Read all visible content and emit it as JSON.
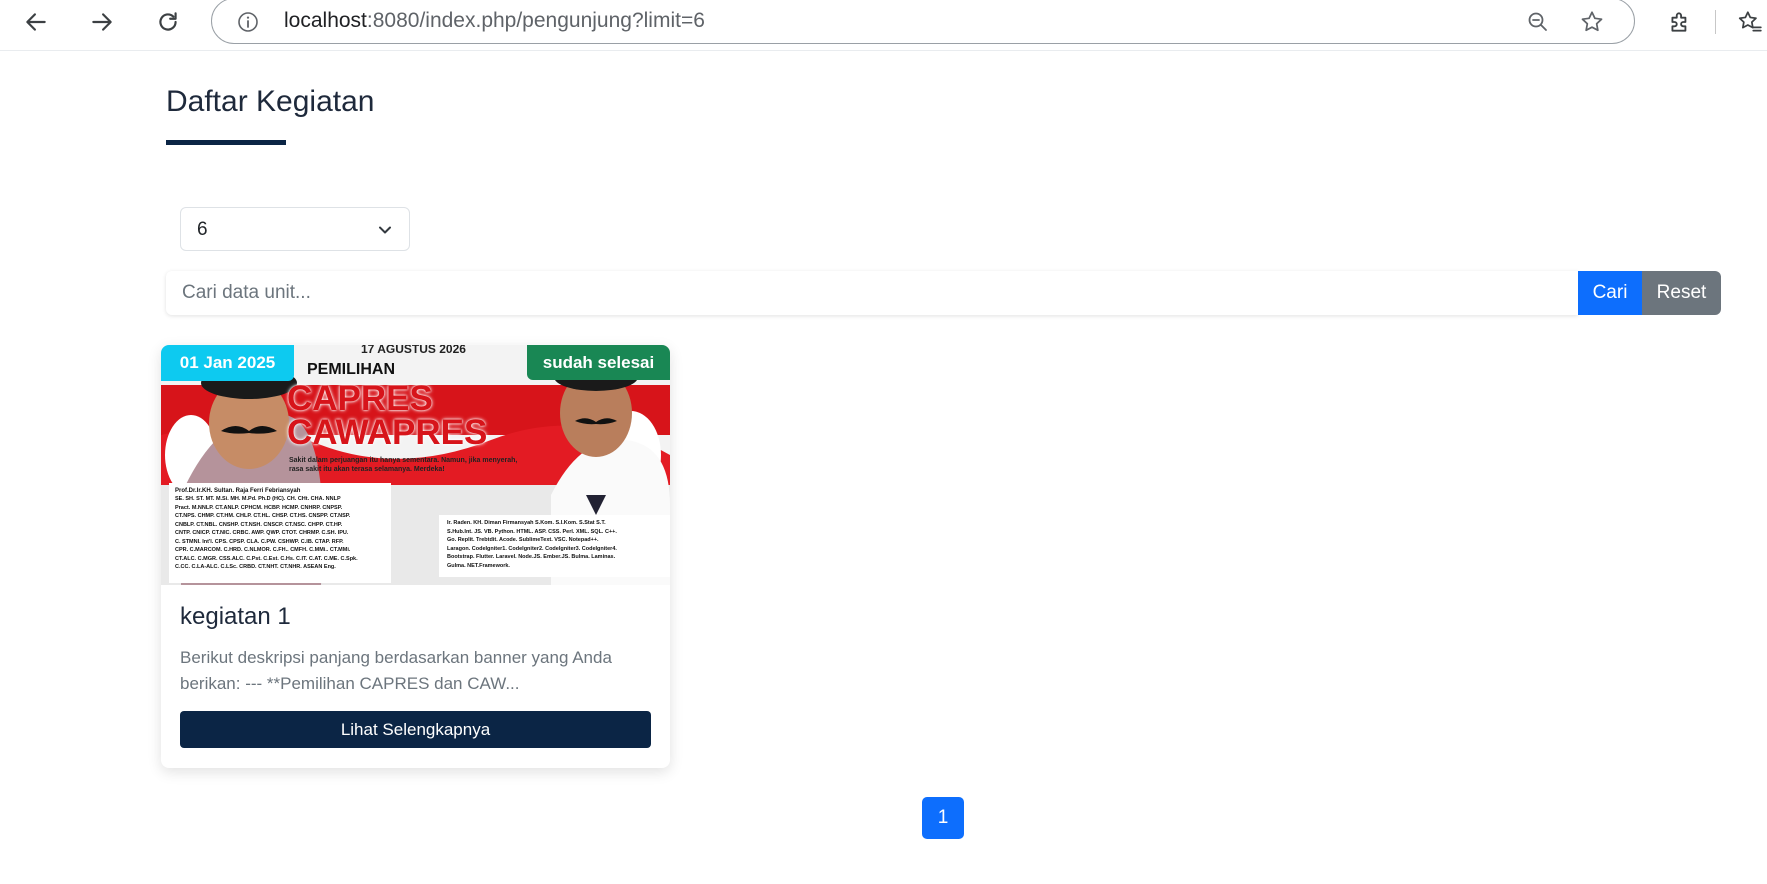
{
  "browser": {
    "url_host": "localhost",
    "url_rest": ":8080/index.php/pengunjung?limit=6"
  },
  "page": {
    "title": "Daftar Kegiatan"
  },
  "filter": {
    "limit_value": "6",
    "search_placeholder": "Cari data unit...",
    "search_button": "Cari",
    "reset_button": "Reset"
  },
  "cards": [
    {
      "date_badge": "01 Jan 2025",
      "status_badge": "sudah selesai",
      "title": "kegiatan 1",
      "description": "Berikut deskripsi panjang berdasarkan banner yang Anda berikan: --- **Pemilihan CAPRES dan CAW...",
      "button": "Lihat Selengkapnya",
      "banner": {
        "date": "17 AGUSTUS 2026",
        "heading_small": "PEMILIHAN",
        "heading_line1": "CAPRES",
        "heading_line2": "CAWAPRES",
        "tagline_1": "Sakit dalam perjuangan itu hanya sementara. Namun, jika menyerah,",
        "tagline_2": "rasa sakit itu akan terasa selamanya. Merdeka!",
        "left_name": "Prof.Dr.Ir.KH. Sultan. Raja Ferri Febriansyah",
        "left_titles": [
          "SE. SH. ST. MT. M.Si. MH. M.Pd. Ph.D (HC). CH. CHt. CHA. NNLP",
          "Pract. M.NNLP. CT.ANLP. CPHCM. HCBP. HCMP. CNHRP. CNPSP.",
          "CT.NPS. CHMP. CT.HM. CHLP. CT.HL. CHSP. CT.HS. CNSPP. CT.NSP.",
          "CNBLP. CT.NBL. CNSHP. CT.NSH. CNSCP. CT.NSC. CHPP. CT.HP.",
          "CNTP. CNICP. CT.NIC. CRBC. AWP. QWP. CTOT. CHRMP. C.SH. IPU.",
          "C. STMNI. Int'l. CPS. CPSP. CLA. C.PW. CSHWP. C.IB. CTAP. RFP.",
          "CPR. C.MARCOM. C.HRD. C.NLMOR. C.FH.. CMFH. C.MMi.. CT.MMi.",
          "CT.ALC. C.MGR. CSS.ALC. C.Pst. C.Est. C.Hs. C.IT. C.AT. C.ME. C.Spk.",
          "C.CC. C.LA-ALC. C.LSc. CRBD. CT.NHT. CT.NHR. ASEAN Eng."
        ],
        "right_titles": [
          "Ir. Raden. KH. Diman Firmansyah S.Kom. S.I.Kom. S.Stat S.T.",
          "S.Hub.Int. JS. VB. Python. HTML. ASP. CSS. Perl. XML. SQL. C++.",
          "Go. Replit. Trebtdit. Acode. SublimeText. VSC. Notepad++.",
          "Laragon. CodeIgniter1. CodeIgniter2. CodeIgniter3. CodeIgniter4.",
          "Bootstrap. Flutter. Laravel. Node.JS. Ember.JS. Bulma. Laminas.",
          "Gulma. NET.Framework."
        ]
      }
    }
  ],
  "pagination": {
    "current": "1"
  },
  "colors": {
    "primary": "#0d6efd",
    "navy": "#0b2545",
    "info": "#0dcaf0",
    "success": "#198754",
    "secondary": "#6c757d",
    "banner_red": "#d7141a"
  }
}
